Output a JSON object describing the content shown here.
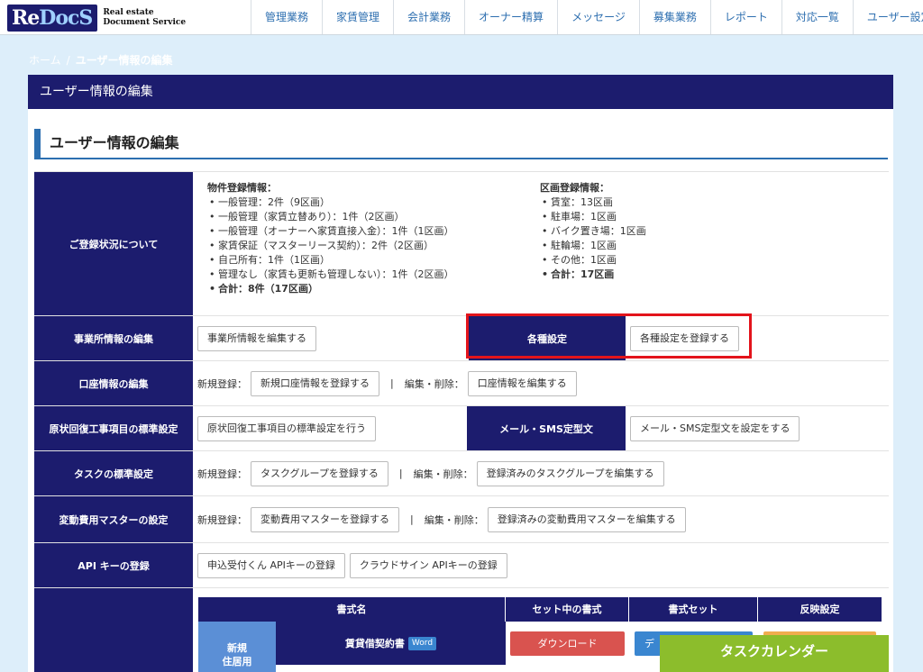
{
  "header": {
    "logo_main_a": "Re",
    "logo_main_b": "DocS",
    "logo_sub_1": "Real estate",
    "logo_sub_2": "Document Service",
    "nav": [
      "管理業務",
      "家賃管理",
      "会計業務",
      "オーナー精算",
      "メッセージ",
      "募集業務",
      "レポート",
      "対応一覧",
      "ユーザー設定"
    ]
  },
  "breadcrumb": {
    "home": "ホーム",
    "sep": "/",
    "current": "ユーザー情報の編集"
  },
  "panel": {
    "header_title": "ユーザー情報の編集",
    "section_title": "ユーザー情報の編集"
  },
  "registration": {
    "label": "ご登録状況について",
    "property": {
      "title": "物件登録情報：",
      "items": [
        "一般管理：2件（9区画）",
        "一般管理（家賃立替あり）：1件（2区画）",
        "一般管理（オーナーへ家賃直接入金）：1件（1区画）",
        "家賃保証（マスターリース契約）：2件（2区画）",
        "自己所有：1件（1区画）",
        "管理なし（家賃も更新も管理しない）：1件（2区画）"
      ],
      "total": "合計：8件（17区画）"
    },
    "unit": {
      "title": "区画登録情報：",
      "items": [
        "賃室：13区画",
        "駐車場：1区画",
        "バイク置き場：1区画",
        "駐輪場：1区画",
        "その他：1区画"
      ],
      "total": "合計：17区画"
    }
  },
  "rows": {
    "office": {
      "label": "事業所情報の編集",
      "button": "事業所情報を編集する",
      "sub_label": "各種設定",
      "sub_button": "各種設定を登録する"
    },
    "account": {
      "label": "口座情報の編集",
      "new_text": "新規登録：",
      "new_button": "新規口座情報を登録する",
      "pipe": "|",
      "edit_text": "編集・削除：",
      "edit_button": "口座情報を編集する"
    },
    "restoration": {
      "label": "原状回復工事項目の標準設定",
      "button": "原状回復工事項目の標準設定を行う",
      "sub_label": "メール・SMS定型文",
      "sub_button": "メール・SMS定型文を設定をする"
    },
    "task": {
      "label": "タスクの標準設定",
      "new_text": "新規登録：",
      "new_button": "タスクグループを登録する",
      "pipe": "|",
      "edit_text": "編集・削除：",
      "edit_button": "登録済みのタスクグループを編集する"
    },
    "variable": {
      "label": "変動費用マスターの設定",
      "new_text": "新規登録：",
      "new_button": "変動費用マスターを登録する",
      "pipe": "|",
      "edit_text": "編集・削除：",
      "edit_button": "登録済みの変動費用マスターを編集する"
    },
    "api": {
      "label": "API キーの登録",
      "button1": "申込受付くん APIキーの登録",
      "button2": "クラウドサイン APIキーの登録"
    }
  },
  "format_table": {
    "headers": [
      "書式名",
      "セット中の書式",
      "書式セット",
      "反映設定"
    ],
    "row_group": "新規",
    "row_group_2": "住居用",
    "doc_name": "賃貸借契約書",
    "doc_badge": "Word",
    "download_button": "ダウンロード",
    "set_button_partial": "デ"
  },
  "task_calendar": "タスクカレンダー",
  "colors": {
    "navy": "#1c1c6e",
    "accent_blue": "#2c6fb0",
    "highlight_red": "#e3141b",
    "download_red": "#d9534f",
    "calendar_green": "#8cbd2c"
  }
}
